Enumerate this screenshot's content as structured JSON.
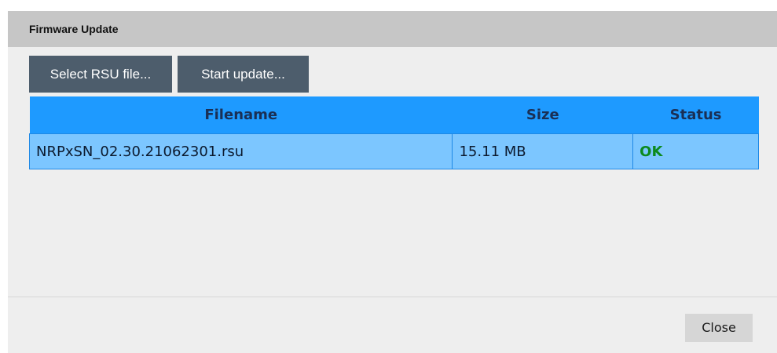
{
  "dialog": {
    "title": "Firmware Update"
  },
  "toolbar": {
    "select_label": "Select RSU file...",
    "start_label": "Start update..."
  },
  "table": {
    "columns": [
      "Filename",
      "Size",
      "Status"
    ],
    "rows": [
      {
        "filename": "NRPxSN_02.30.21062301.rsu",
        "size": "15.11 MB",
        "status": "OK"
      }
    ]
  },
  "footer": {
    "close_label": "Close"
  },
  "colors": {
    "header_bg": "#1e9aff",
    "row_bg": "#7cc6ff",
    "button_dark": "#4d5d6c",
    "status_ok": "#0c8a1e"
  }
}
